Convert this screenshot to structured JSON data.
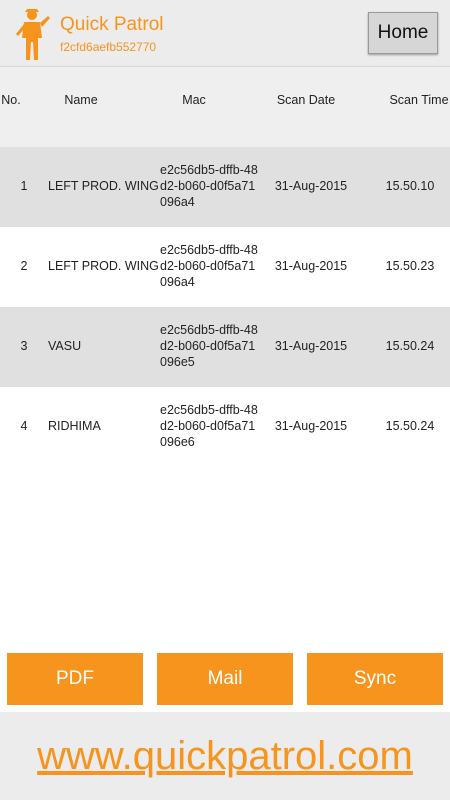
{
  "header": {
    "app_title": "Quick Patrol",
    "device_id": "f2cfd6aefb552770",
    "home_label": "Home",
    "logo_icon": "security-guard-icon"
  },
  "table": {
    "columns": [
      "No.",
      "Name",
      "Mac",
      "Scan Date",
      "Scan Time"
    ],
    "rows": [
      {
        "no": "1",
        "name": "LEFT PROD. WING",
        "mac": "e2c56db5-dffb-48d2-b060-d0f5a71096a4",
        "date": "31-Aug-2015",
        "time": "15.50.10"
      },
      {
        "no": "2",
        "name": "LEFT PROD. WING",
        "mac": "e2c56db5-dffb-48d2-b060-d0f5a71096a4",
        "date": "31-Aug-2015",
        "time": "15.50.23"
      },
      {
        "no": "3",
        "name": "VASU",
        "mac": "e2c56db5-dffb-48d2-b060-d0f5a71096e5",
        "date": "31-Aug-2015",
        "time": "15.50.24"
      },
      {
        "no": "4",
        "name": "RIDHIMA",
        "mac": "e2c56db5-dffb-48d2-b060-d0f5a71096e6",
        "date": "31-Aug-2015",
        "time": "15.50.24"
      }
    ]
  },
  "actions": {
    "pdf_label": "PDF",
    "mail_label": "Mail",
    "sync_label": "Sync"
  },
  "footer": {
    "website": "www.quickpatrol.com"
  },
  "colors": {
    "accent": "#f7941d",
    "row_alt": "#e0e0e0"
  }
}
